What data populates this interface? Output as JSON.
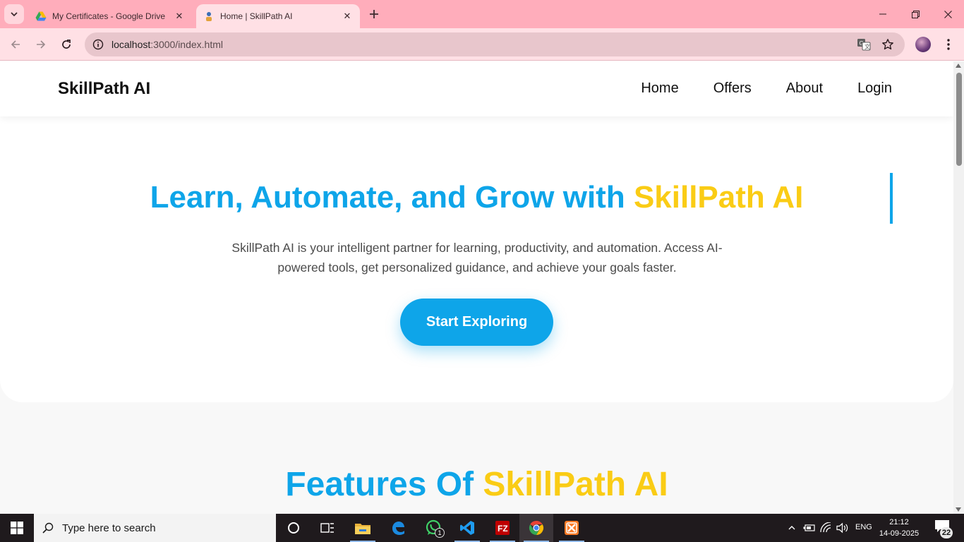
{
  "browser": {
    "tabs": [
      {
        "title": "My Certificates - Google Drive",
        "favicon": "google-drive-icon",
        "active": false
      },
      {
        "title": "Home | SkillPath AI",
        "favicon": "skillpath-icon",
        "active": true
      }
    ],
    "address": {
      "host": "localhost",
      "path": ":3000/index.html"
    },
    "theme_color": "#ffadbb"
  },
  "page": {
    "brand": "SkillPath AI",
    "nav": [
      "Home",
      "Offers",
      "About",
      "Login"
    ],
    "hero": {
      "title_main": "Learn, Automate, and Grow with ",
      "title_accent": "SkillPath AI",
      "description": "SkillPath AI is your intelligent partner for learning, productivity, and automation. Access AI-powered tools, get personalized guidance, and achieve your goals faster.",
      "cta": "Start Exploring"
    },
    "features": {
      "title_main": "Features Of ",
      "title_accent": "SkillPath AI"
    },
    "colors": {
      "primary": "#0ea5e9",
      "accent": "#facc15",
      "text": "#111111"
    }
  },
  "taskbar": {
    "search_placeholder": "Type here to search",
    "apps": [
      "cortana-icon",
      "task-view-icon",
      "file-explorer-icon",
      "edge-icon",
      "whatsapp-icon",
      "vscode-icon",
      "filezilla-icon",
      "chrome-icon",
      "xampp-icon"
    ],
    "whatsapp_badge": "1",
    "language": "ENG",
    "time": "21:12",
    "date": "14-09-2025",
    "notification_count": "22"
  }
}
